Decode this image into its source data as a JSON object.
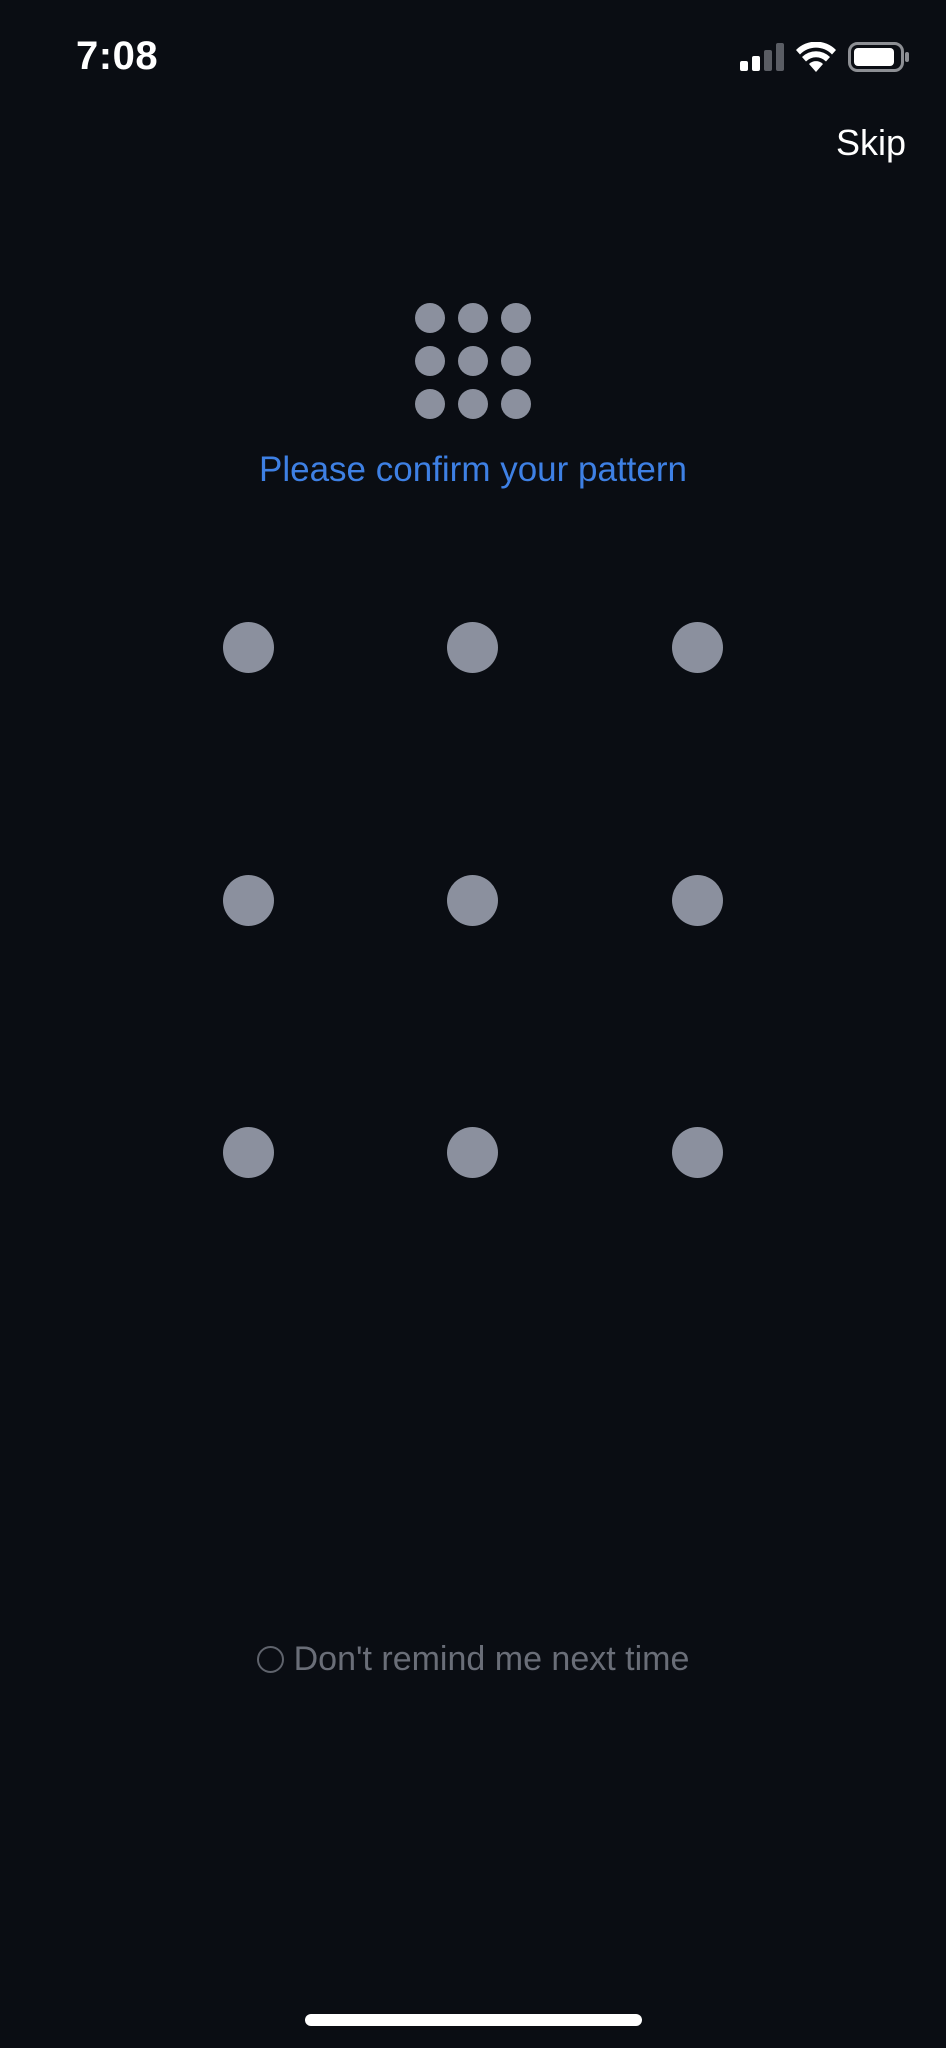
{
  "status_bar": {
    "time": "7:08",
    "signal_icon": "cellular-signal-icon",
    "wifi_icon": "wifi-icon",
    "battery_icon": "battery-icon"
  },
  "header": {
    "skip_label": "Skip"
  },
  "logo": {
    "icon": "pattern-grid-logo-icon"
  },
  "prompt": {
    "text": "Please confirm your pattern",
    "color": "#3e80e4"
  },
  "pattern": {
    "rows": 3,
    "cols": 3,
    "dot_color": "#8b909e"
  },
  "footer": {
    "remind_label": "Don't remind me next time",
    "remind_checked": false
  },
  "colors": {
    "background": "#0a0d13",
    "accent": "#3e80e4",
    "dot": "#8b909e",
    "muted_text": "#6a6e78"
  }
}
